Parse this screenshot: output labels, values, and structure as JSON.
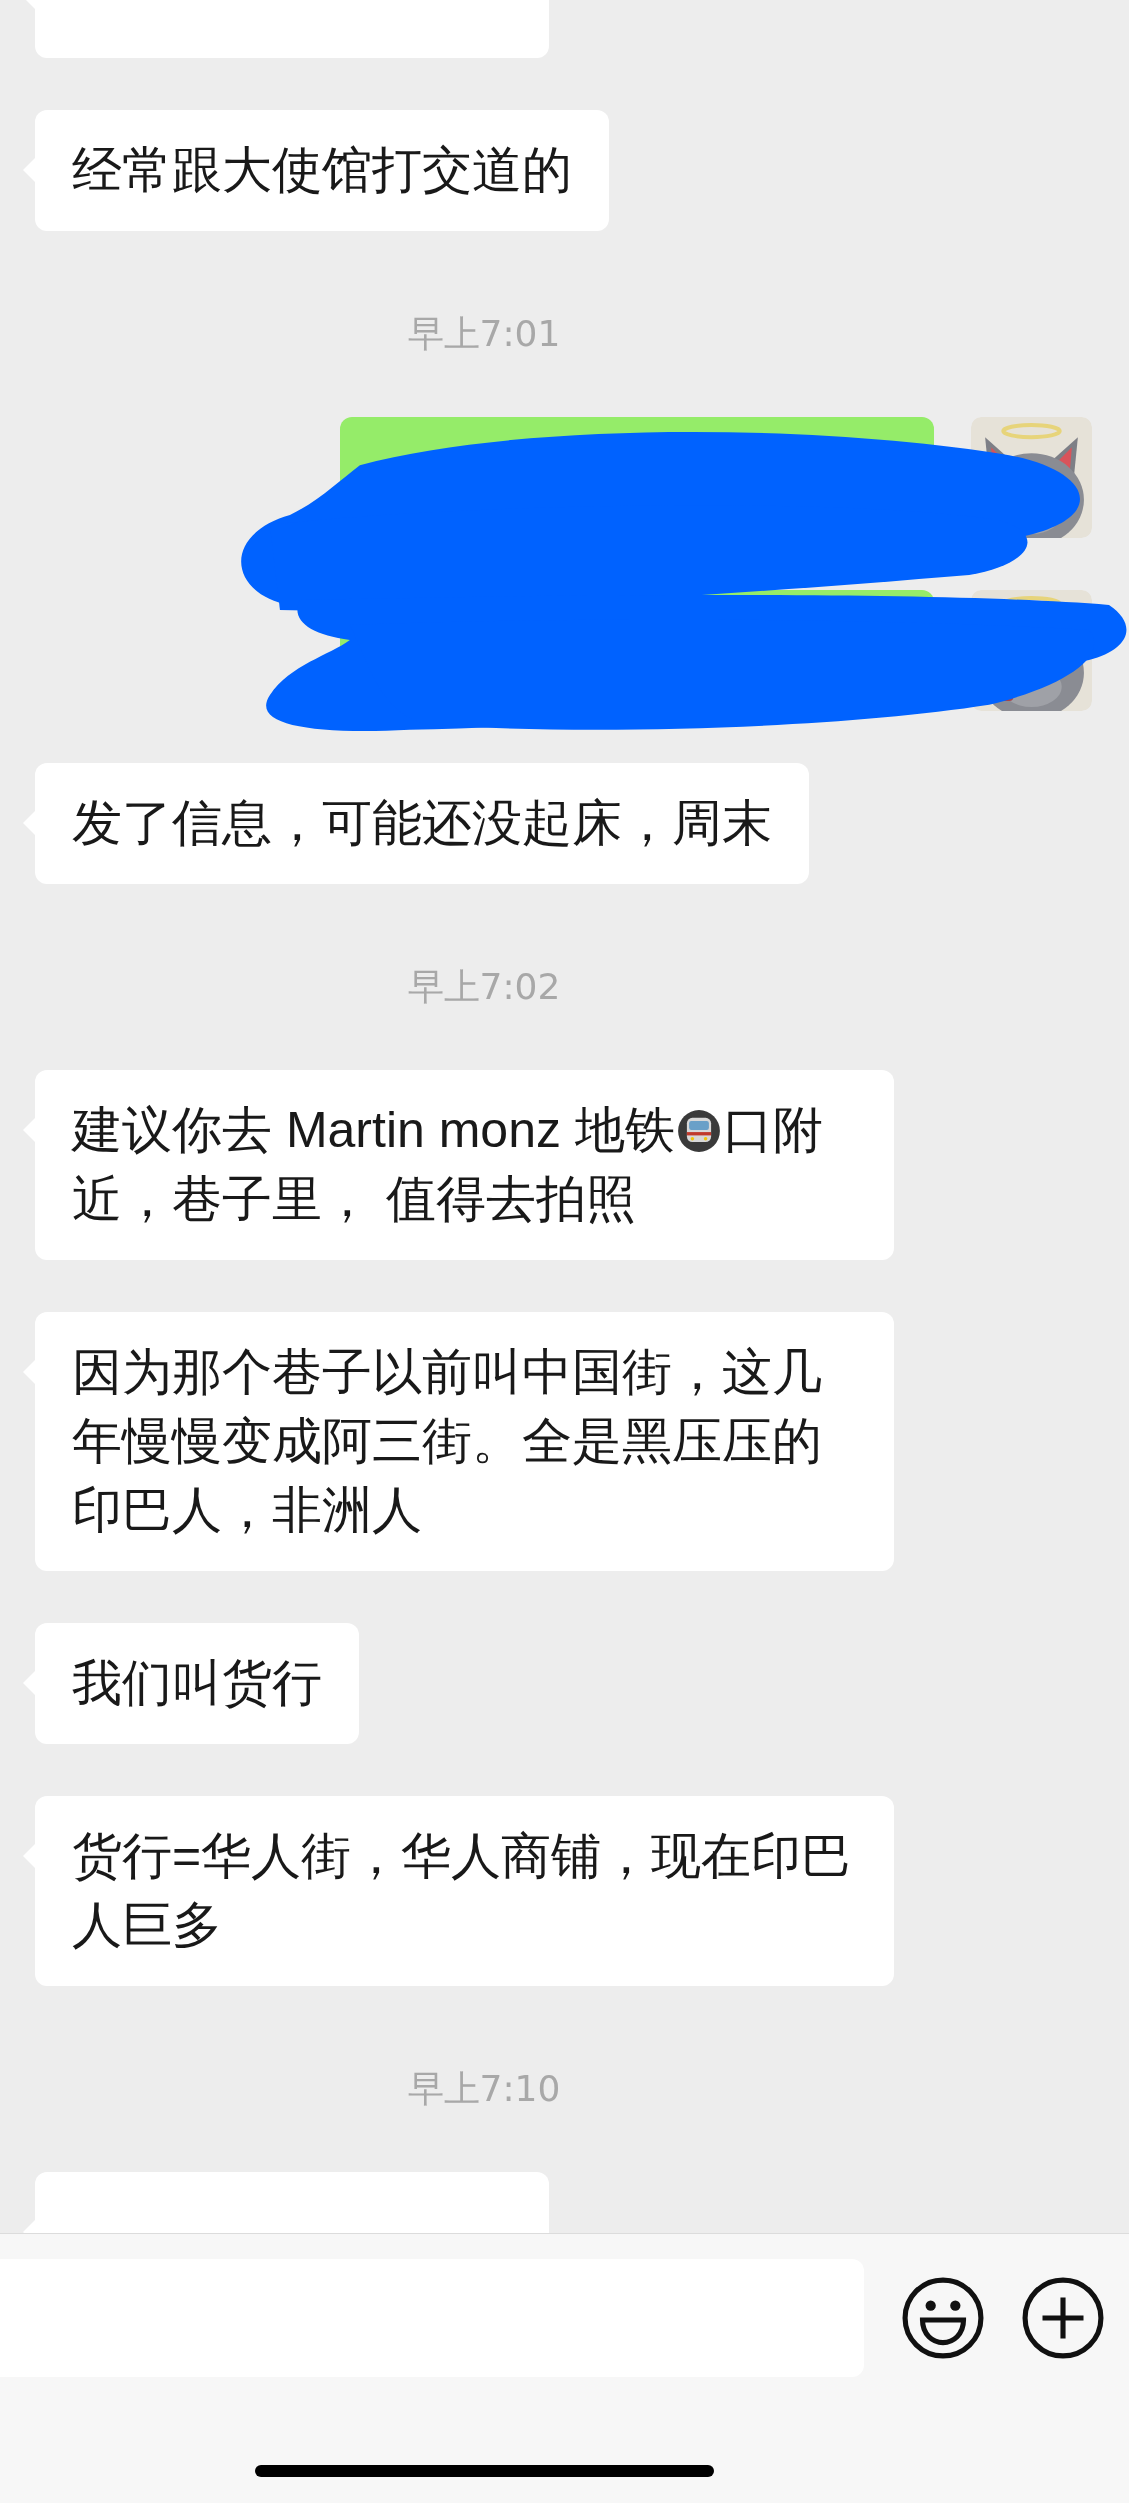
{
  "messages": [
    {
      "kind": "received-cut"
    },
    {
      "kind": "received",
      "parts": [
        {
          "kind": "text",
          "text": "经常跟大使馆打交道的"
        }
      ]
    },
    {
      "kind": "time",
      "text": "早上7:01"
    },
    {
      "kind": "sent"
    },
    {
      "kind": "sent"
    },
    {
      "kind": "received",
      "parts": [
        {
          "kind": "text",
          "text": "发了信息，可能还没起床，周末"
        }
      ]
    },
    {
      "kind": "time",
      "text": "早上7:02"
    },
    {
      "kind": "received",
      "parts": [
        {
          "kind": "text",
          "text": "建议你去 Martin monz 地铁"
        },
        {
          "kind": "metro-icon"
        },
        {
          "kind": "text",
          "text": "口附近，巷子里， 值得去拍照"
        }
      ]
    },
    {
      "kind": "received",
      "parts": [
        {
          "kind": "text",
          "text": "因为那个巷子以前叫中国街，这几年慢慢变成阿三街。全是黑压压的印巴人，非洲人"
        }
      ]
    },
    {
      "kind": "received",
      "parts": [
        {
          "kind": "text",
          "text": "我们叫货行"
        }
      ]
    },
    {
      "kind": "received",
      "parts": [
        {
          "kind": "text",
          "text": "货行=华人街，华人商铺，现在印巴人巨多"
        }
      ]
    },
    {
      "kind": "time",
      "text": "早上7:10"
    },
    {
      "kind": "received-cut"
    }
  ],
  "redaction_scribble": true
}
